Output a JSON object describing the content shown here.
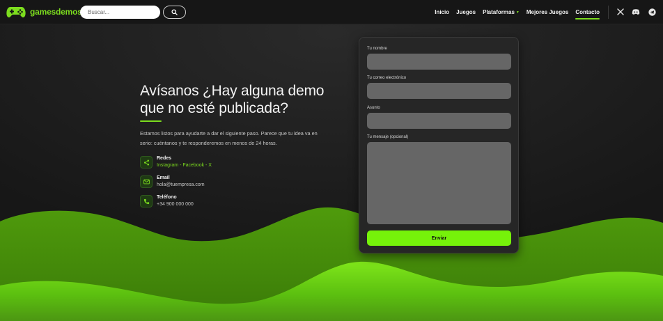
{
  "brand": {
    "name": "gamesdemos",
    "accent": "#7cdc1e"
  },
  "header": {
    "search_placeholder": "Buscar...",
    "nav": [
      {
        "label": "Inicio"
      },
      {
        "label": "Juegos"
      },
      {
        "label": "Plataformas",
        "dropdown": true
      },
      {
        "label": "Mejores Juegos"
      },
      {
        "label": "Contacto",
        "active": true
      }
    ],
    "social_icons": [
      "x-icon",
      "discord-icon",
      "telegram-icon"
    ]
  },
  "hero": {
    "title_line1": "Avísanos ¿Hay alguna demo",
    "title_line2": "que no esté publicada?",
    "description": "Estamos listos para ayudarte a dar el siguiente paso. Parece que tu idea va en serio: cuéntanos y te responderemos en menos de 24 horas.",
    "contacts": [
      {
        "icon": "share-icon",
        "label": "Redes",
        "value": "Instagram - Facebook - X"
      },
      {
        "icon": "mail-icon",
        "label": "Email",
        "value": "hola@tuempresa.com"
      },
      {
        "icon": "phone-icon",
        "label": "Teléfono",
        "value": "+34 900 000 000"
      }
    ]
  },
  "form": {
    "name_label": "Tu nombre",
    "email_label": "Tu correo electrónico",
    "subject_label": "Asunto",
    "message_label": "Tu mensaje (opcional)",
    "submit_label": "Enviar"
  },
  "colors": {
    "button": "#76f20a",
    "input": "#666666",
    "card": "#262626"
  }
}
